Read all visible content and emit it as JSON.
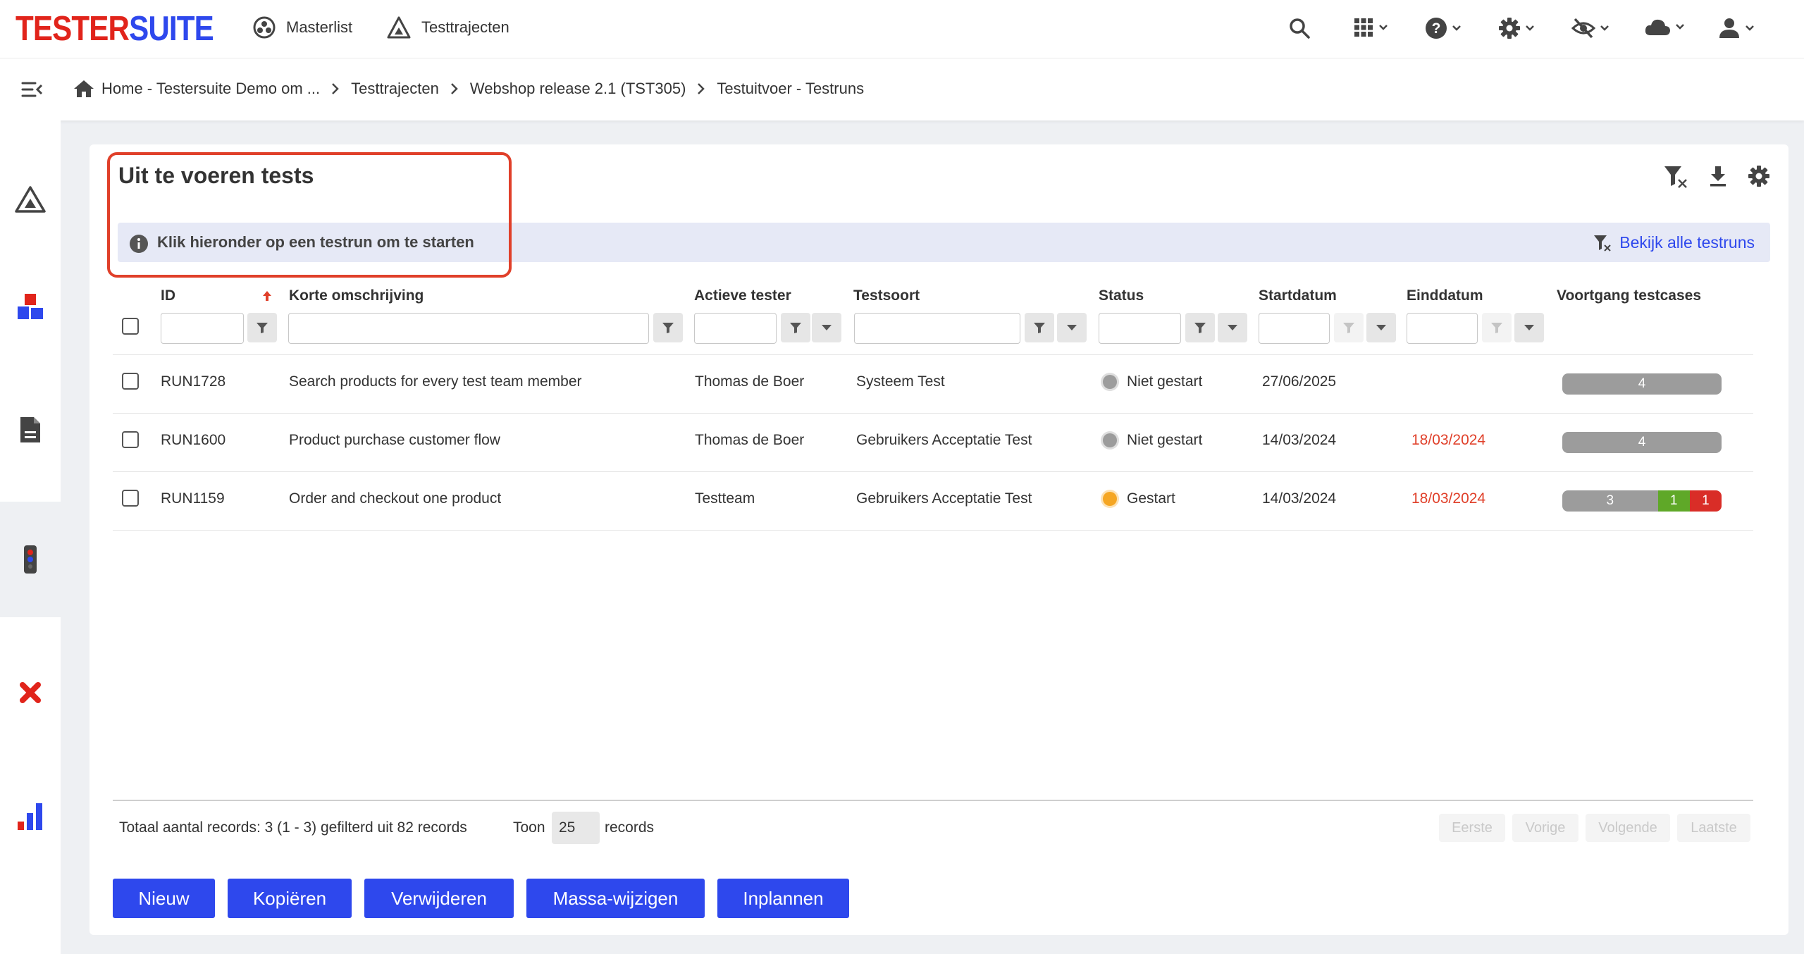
{
  "app": {
    "logo_part1": "TESTER",
    "logo_part2": "SUITE",
    "brand_colors": {
      "red": "#e1241b",
      "blue": "#2e48ed"
    }
  },
  "topnav": {
    "masterlist": "Masterlist",
    "testtrajecten": "Testtrajecten"
  },
  "topicons": [
    "search-icon",
    "apps-grid-icon",
    "help-icon",
    "settings-gear-icon",
    "visibility-off-icon",
    "cloud-icon",
    "user-icon"
  ],
  "breadcrumb": {
    "home": "Home - Testersuite Demo om ...",
    "item2": "Testtrajecten",
    "item3": "Webshop release 2.1 (TST305)",
    "item4": "Testuitvoer - Testruns"
  },
  "sidebar": [
    "testtrajecten-icon",
    "blocks-icon",
    "document-icon",
    "testrun-icon",
    "defect-icon",
    "reports-icon"
  ],
  "card": {
    "title": "Uit te voeren tests",
    "info_message": "Klik hieronder op een testrun om te starten",
    "show_all": "Bekijk alle testruns"
  },
  "table": {
    "headers": {
      "id": "ID",
      "desc": "Korte omschrijving",
      "tester": "Actieve tester",
      "type": "Testsoort",
      "status": "Status",
      "start": "Startdatum",
      "end": "Einddatum",
      "progress": "Voortgang testcases"
    },
    "rows": [
      {
        "id": "RUN1728",
        "desc": "Search products for every test team member",
        "tester": "Thomas de Boer",
        "type": "Systeem Test",
        "status": "Niet gestart",
        "start": "27/06/2025",
        "end": "",
        "progress": {
          "not_run": "4",
          "passed": "",
          "failed": ""
        }
      },
      {
        "id": "RUN1600",
        "desc": "Product purchase customer flow",
        "tester": "Thomas de Boer",
        "type": "Gebruikers Acceptatie Test",
        "status": "Niet gestart",
        "start": "14/03/2024",
        "end": "18/03/2024",
        "progress": {
          "not_run": "4",
          "passed": "",
          "failed": ""
        }
      },
      {
        "id": "RUN1159",
        "desc": "Order and checkout one product",
        "tester": "Testteam",
        "type": "Gebruikers Acceptatie Test",
        "status": "Gestart",
        "start": "14/03/2024",
        "end": "18/03/2024",
        "progress": {
          "not_run": "3",
          "passed": "1",
          "failed": "1"
        }
      }
    ]
  },
  "footer": {
    "total": "Totaal aantal records: 3 (1 - 3) gefilterd uit 82 records",
    "toon": "Toon",
    "page_size": "25",
    "records": "records",
    "first": "Eerste",
    "prev": "Vorige",
    "next": "Volgende",
    "last": "Laatste"
  },
  "buttons": {
    "new": "Nieuw",
    "copy": "Kopiëren",
    "delete": "Verwijderen",
    "mass_edit": "Massa-wijzigen",
    "schedule": "Inplannen"
  },
  "colors": {
    "status_not_started": "#9c9c9c",
    "status_started": "#f5a623",
    "progress_not_run": "#9c9c9c",
    "progress_passed": "#5fa828",
    "progress_failed": "#d92d27",
    "overdue_date": "#e0402a"
  }
}
